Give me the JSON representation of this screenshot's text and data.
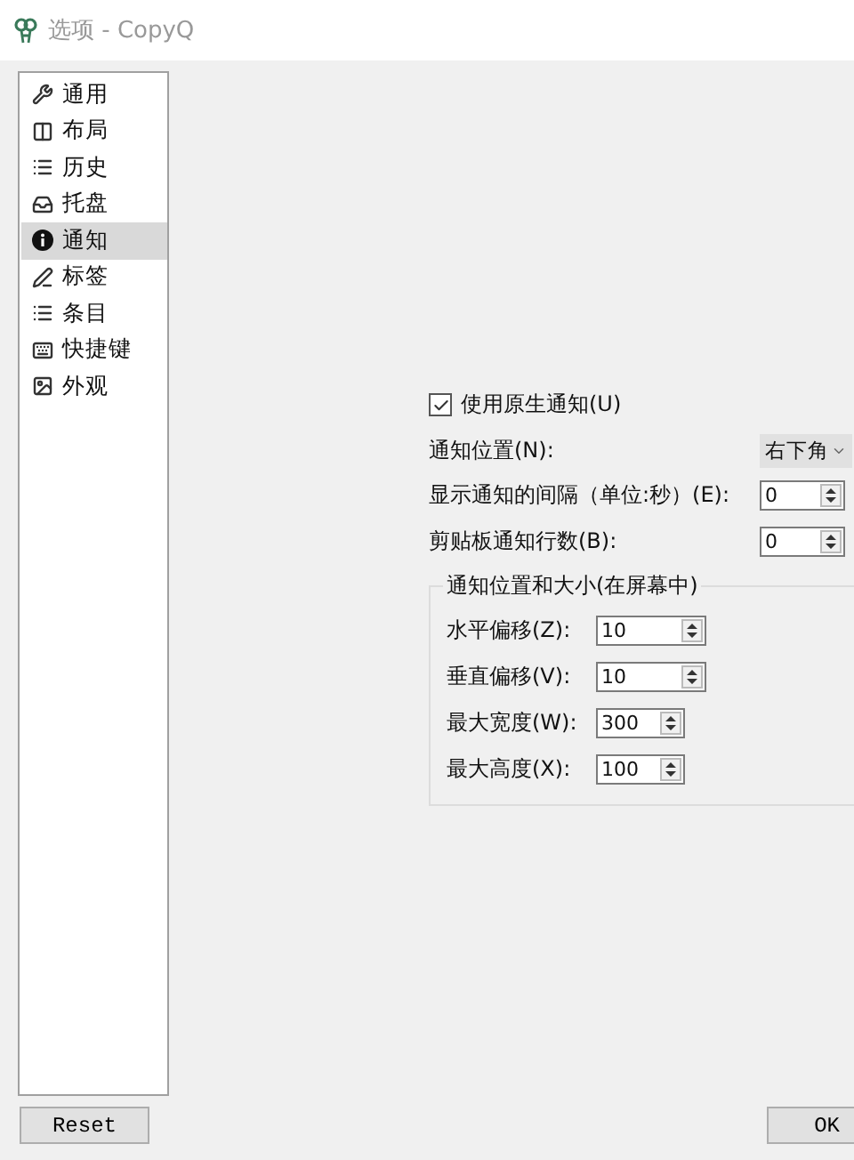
{
  "window": {
    "title": "选项 - CopyQ"
  },
  "sidebar": {
    "items": [
      {
        "label": "通用",
        "selected": false
      },
      {
        "label": "布局",
        "selected": false
      },
      {
        "label": "历史",
        "selected": false
      },
      {
        "label": "托盘",
        "selected": false
      },
      {
        "label": "通知",
        "selected": true
      },
      {
        "label": "标签",
        "selected": false
      },
      {
        "label": "条目",
        "selected": false
      },
      {
        "label": "快捷键",
        "selected": false
      },
      {
        "label": "外观",
        "selected": false
      }
    ]
  },
  "settings": {
    "native": {
      "label": "使用原生通知(U)",
      "checked": true
    },
    "rows": [
      {
        "kind": "combo",
        "label": "通知位置(N):",
        "value": "右下角"
      },
      {
        "kind": "spin",
        "label": "显示通知的间隔（单位:秒）(E):",
        "value": "0"
      },
      {
        "kind": "spin",
        "label": "剪贴板通知行数(B):",
        "value": "0"
      }
    ],
    "group": {
      "title": "通知位置和大小(在屏幕中)",
      "fields": [
        {
          "label": "水平偏移(Z):",
          "value": "10"
        },
        {
          "label": "垂直偏移(V):",
          "value": "10"
        },
        {
          "label": "最大宽度(W):",
          "value": "300"
        },
        {
          "label": "最大高度(X):",
          "value": "100"
        }
      ]
    }
  },
  "buttons": {
    "reset": "Reset",
    "ok": "OK"
  }
}
